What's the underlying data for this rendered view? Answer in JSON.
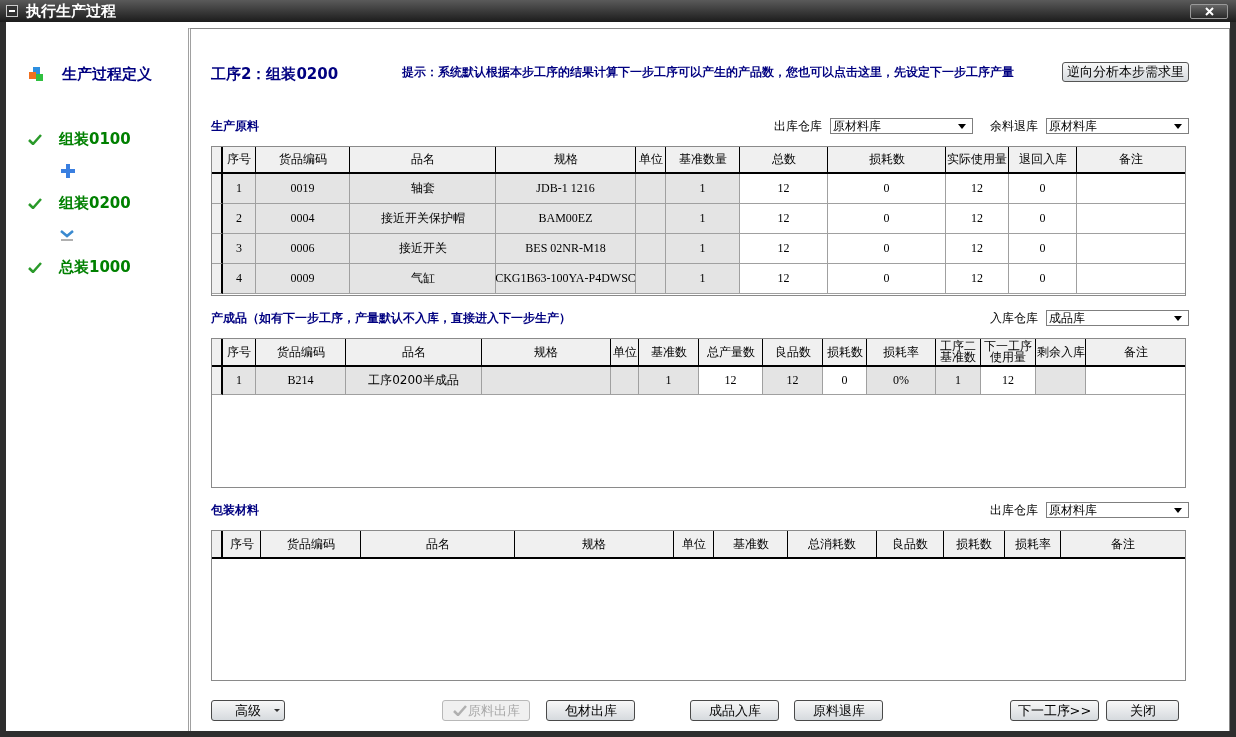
{
  "window": {
    "title": "执行生产过程"
  },
  "sidebar": {
    "items": [
      {
        "kind": "title",
        "label": "生产过程定义"
      },
      {
        "kind": "step",
        "label": "组装0100",
        "done": true
      },
      {
        "kind": "add"
      },
      {
        "kind": "step",
        "label": "组装0200",
        "done": true
      },
      {
        "kind": "next"
      },
      {
        "kind": "step",
        "label": "总装1000",
        "done": true
      }
    ]
  },
  "step_title": "工序2：组装0200",
  "hint": "提示：系统默认根据本步工序的结果计算下一步工序可以产生的产品数，您也可以点击这里，先设定下一步工序产量",
  "reverse_button": "逆向分析本步需求里",
  "sections": [
    {
      "title": "生产原料",
      "selects": [
        {
          "label": "出库仓库",
          "value": "原材料库"
        },
        {
          "label": "余料退库",
          "value": "原材料库"
        }
      ],
      "columns": [
        "序号",
        "货品编码",
        "品名",
        "规格",
        "单位",
        "基准数量",
        "总数",
        "损耗数",
        "实际使用量",
        "退回入库",
        "备注"
      ],
      "rows": [
        [
          {
            "text": "1",
            "readonly": true
          },
          {
            "text": "0019",
            "readonly": true
          },
          {
            "text": "轴套",
            "readonly": true
          },
          {
            "text": "JDB-1 1216",
            "readonly": true
          },
          {
            "readonly": true
          },
          {
            "text": "1",
            "readonly": true
          },
          {
            "text": "12",
            "readonly": false
          },
          {
            "text": "0",
            "readonly": false
          },
          {
            "text": "12",
            "readonly": false
          },
          {
            "text": "0",
            "readonly": false
          },
          {
            "readonly": false
          }
        ],
        [
          {
            "text": "2",
            "readonly": true
          },
          {
            "text": "0004",
            "readonly": true
          },
          {
            "text": "接近开关保护帽",
            "readonly": true
          },
          {
            "text": "BAM00EZ",
            "readonly": true
          },
          {
            "readonly": true
          },
          {
            "text": "1",
            "readonly": true
          },
          {
            "text": "12",
            "readonly": false
          },
          {
            "text": "0",
            "readonly": false
          },
          {
            "text": "12",
            "readonly": false
          },
          {
            "text": "0",
            "readonly": false
          },
          {
            "readonly": false
          }
        ],
        [
          {
            "text": "3",
            "readonly": true
          },
          {
            "text": "0006",
            "readonly": true
          },
          {
            "text": "接近开关",
            "readonly": true
          },
          {
            "text": "BES 02NR-M18",
            "readonly": true
          },
          {
            "readonly": true
          },
          {
            "text": "1",
            "readonly": true
          },
          {
            "text": "12",
            "readonly": false
          },
          {
            "text": "0",
            "readonly": false
          },
          {
            "text": "12",
            "readonly": false
          },
          {
            "text": "0",
            "readonly": false
          },
          {
            "readonly": false
          }
        ],
        [
          {
            "text": "4",
            "readonly": true
          },
          {
            "text": "0009",
            "readonly": true
          },
          {
            "text": "气缸",
            "readonly": true
          },
          {
            "text": "CKG1B63-100YA-P4DWSC",
            "readonly": true
          },
          {
            "readonly": true
          },
          {
            "text": "1",
            "readonly": true
          },
          {
            "text": "12",
            "readonly": false
          },
          {
            "text": "0",
            "readonly": false
          },
          {
            "text": "12",
            "readonly": false
          },
          {
            "text": "0",
            "readonly": false
          },
          {
            "readonly": false
          }
        ]
      ]
    },
    {
      "title": "产成品（如有下一步工序，产量默认不入库，直接进入下一步生产）",
      "selects": [
        {
          "label": "入库仓库",
          "value": "成品库"
        }
      ],
      "columns": [
        "序号",
        "货品编码",
        "品名",
        "规格",
        "单位",
        "基准数",
        "总产量数",
        "良品数",
        "损耗数",
        "损耗率",
        "工序二基准数",
        "下一工序使用量",
        "剩余入库",
        "备注"
      ],
      "rows": [
        [
          {
            "text": "1",
            "readonly": true
          },
          {
            "text": "B214",
            "readonly": true
          },
          {
            "text": "工序0200半成品",
            "readonly": true
          },
          {
            "readonly": true
          },
          {
            "readonly": true
          },
          {
            "text": "1",
            "readonly": true
          },
          {
            "text": "12",
            "readonly": false
          },
          {
            "text": "12",
            "readonly": true
          },
          {
            "text": "0",
            "readonly": false
          },
          {
            "text": "0%",
            "readonly": true
          },
          {
            "text": "1",
            "readonly": true
          },
          {
            "text": "12",
            "readonly": false
          },
          {
            "readonly": true
          },
          {
            "readonly": false
          }
        ]
      ]
    },
    {
      "title": "包装材料",
      "selects": [
        {
          "label": "出库仓库",
          "value": "原材料库"
        }
      ],
      "columns": [
        "序号",
        "货品编码",
        "品名",
        "规格",
        "单位",
        "基准数",
        "总消耗数",
        "良品数",
        "损耗数",
        "损耗率",
        "备注"
      ]
    }
  ],
  "buttons": [
    {
      "label": "高级",
      "kind": "dropdown",
      "disabled": false
    },
    {
      "label": "原料出库",
      "kind": "check",
      "disabled": true
    },
    {
      "label": "包材出库",
      "kind": "plain",
      "disabled": false
    },
    {
      "label": "成品入库",
      "kind": "plain",
      "disabled": false
    },
    {
      "label": "原料退库",
      "kind": "plain",
      "disabled": false
    },
    {
      "label": "下一工序>>",
      "kind": "plain",
      "disabled": false
    },
    {
      "label": "关闭",
      "kind": "plain",
      "disabled": false
    }
  ]
}
